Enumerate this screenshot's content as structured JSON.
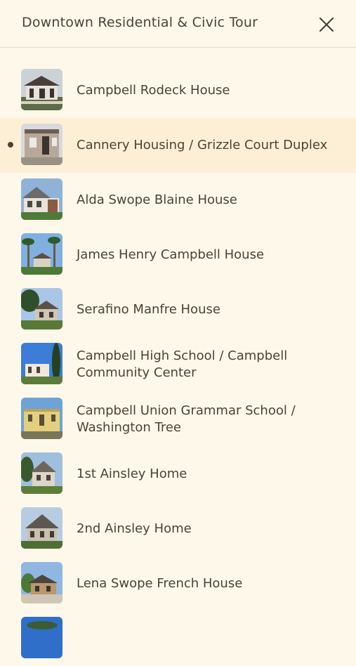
{
  "header": {
    "title": "Downtown Residential & Civic Tour",
    "close_icon": "close-icon"
  },
  "stops": [
    {
      "name": "Campbell Rodeck House",
      "current": false
    },
    {
      "name": "Cannery Housing / Grizzle Court Duplex",
      "current": true
    },
    {
      "name": "Alda Swope Blaine House",
      "current": false
    },
    {
      "name": "James Henry Campbell House",
      "current": false
    },
    {
      "name": "Serafino Manfre House",
      "current": false
    },
    {
      "name": "Campbell High School / Campbell Community Center",
      "current": false
    },
    {
      "name": "Campbell Union Grammar School / Washington Tree",
      "current": false
    },
    {
      "name": "1st Ainsley Home",
      "current": false
    },
    {
      "name": "2nd Ainsley Home",
      "current": false
    },
    {
      "name": "Lena Swope French House",
      "current": false
    },
    {
      "name": "",
      "current": false
    }
  ],
  "colors": {
    "background": "#fdf8ea",
    "active_row": "#fcefd6",
    "text": "#4a4338",
    "divider": "#e2dccb"
  }
}
